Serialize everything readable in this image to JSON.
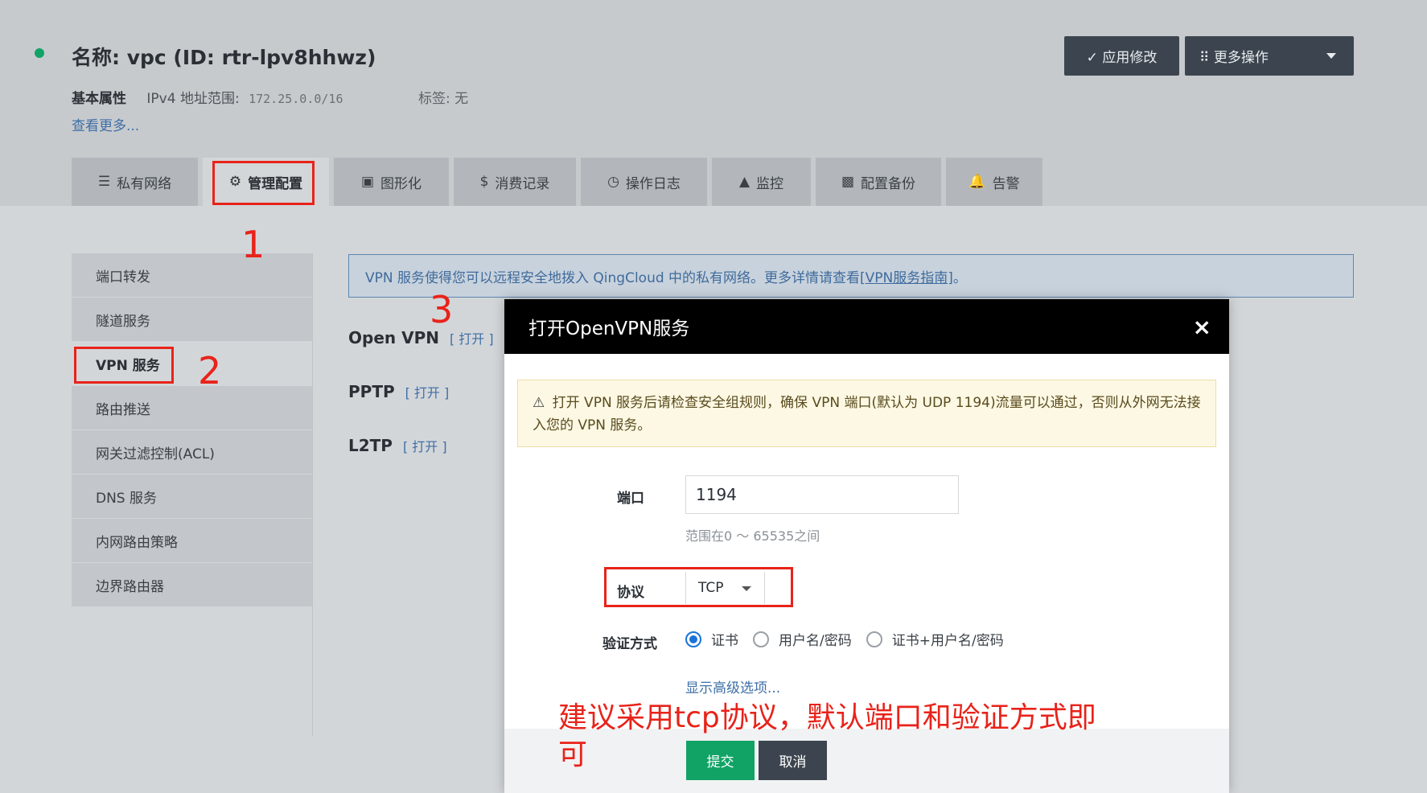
{
  "header": {
    "title": "名称: vpc (ID: rtr-lpv8hhwz)",
    "attr_label": "基本属性",
    "ipv4_label": "IPv4 地址范围:",
    "ipv4_value": "172.25.0.0/16",
    "tags_text": "标签: 无",
    "see_more": "查看更多...",
    "apply_button": "✓ 应用修改",
    "more_button": "⠿ 更多操作"
  },
  "tabs": [
    {
      "icon": "☰",
      "label": "私有网络"
    },
    {
      "icon": "⚙",
      "label": "管理配置"
    },
    {
      "icon": "▣",
      "label": "图形化"
    },
    {
      "icon": "$",
      "label": "消费记录"
    },
    {
      "icon": "◷",
      "label": "操作日志"
    },
    {
      "icon": "▲",
      "label": "监控"
    },
    {
      "icon": "▩",
      "label": "配置备份"
    },
    {
      "icon": "🔔",
      "label": "告警"
    }
  ],
  "sidebar": {
    "items": [
      {
        "label": "端口转发"
      },
      {
        "label": "隧道服务"
      },
      {
        "label": "VPN 服务"
      },
      {
        "label": "路由推送"
      },
      {
        "label": "网关过滤控制(ACL)"
      },
      {
        "label": "DNS 服务"
      },
      {
        "label": "内网路由策略"
      },
      {
        "label": "边界路由器"
      }
    ]
  },
  "info": {
    "text": "VPN 服务使得您可以远程安全地拨入 QingCloud 中的私有网络。更多详情请查看",
    "link": "[VPN服务指南]",
    "end": "。"
  },
  "vpn_list": [
    {
      "name": "Open VPN",
      "action": "[ 打开 ]"
    },
    {
      "name": "PPTP",
      "action": "[ 打开 ]"
    },
    {
      "name": "L2TP",
      "action": "[ 打开 ]"
    }
  ],
  "modal": {
    "title": "打开OpenVPN服务",
    "close": "×",
    "warning": "打开 VPN 服务后请检查安全组规则，确保 VPN 端口(默认为 UDP 1194)流量可以通过，否则从外网无法接入您的 VPN 服务。",
    "warning_icon": "⚠",
    "port_label": "端口",
    "port_value": "1194",
    "port_hint": "范围在0 ～ 65535之间",
    "protocol_label": "协议",
    "protocol_value": "TCP",
    "auth_label": "验证方式",
    "auth_options": [
      "证书",
      "用户名/密码",
      "证书+用户名/密码"
    ],
    "advanced_link": "显示高级选项...",
    "submit": "提交",
    "cancel": "取消"
  },
  "annotations": {
    "num1": "1",
    "num2": "2",
    "num3": "3",
    "note": "建议采用tcp协议，默认端口和验证方式即可"
  },
  "colors": {
    "annotation_red": "#e8231a",
    "primary_green": "#11a366",
    "dark_button": "#3c454f",
    "link_blue": "#3f6fa6"
  }
}
